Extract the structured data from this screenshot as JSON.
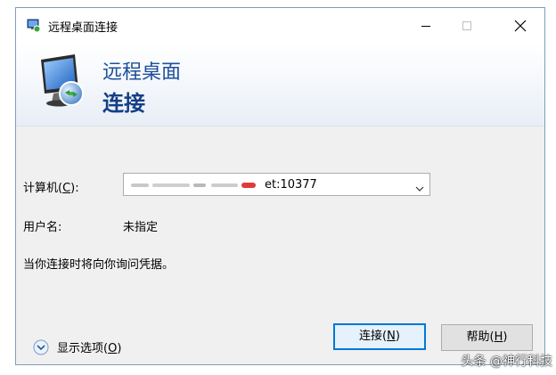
{
  "window": {
    "title": "远程桌面连接",
    "controls": {
      "minimize": "–",
      "maximize": "□",
      "close": "✕"
    }
  },
  "banner": {
    "line1": "远程桌面",
    "line2": "连接",
    "icon": "monitor-connection-icon"
  },
  "form": {
    "computer_label_prefix": "计算机(",
    "computer_label_key": "C",
    "computer_label_suffix": "):",
    "computer_value_visible": "et:10377",
    "username_label": "用户名:",
    "username_value": "未指定",
    "note": "当你连接时将向你询问凭据。"
  },
  "footer": {
    "options_prefix": "显示选项(",
    "options_key": "O",
    "options_suffix": ")",
    "connect_prefix": "连接(",
    "connect_key": "N",
    "connect_suffix": ")",
    "help_prefix": "帮助(",
    "help_key": "H",
    "help_suffix": ")"
  },
  "watermark": "头条 @神行科技",
  "colors": {
    "accent": "#0078d7",
    "banner_title": "#1c4f9c",
    "dialog_bg": "#f0f0f0"
  }
}
